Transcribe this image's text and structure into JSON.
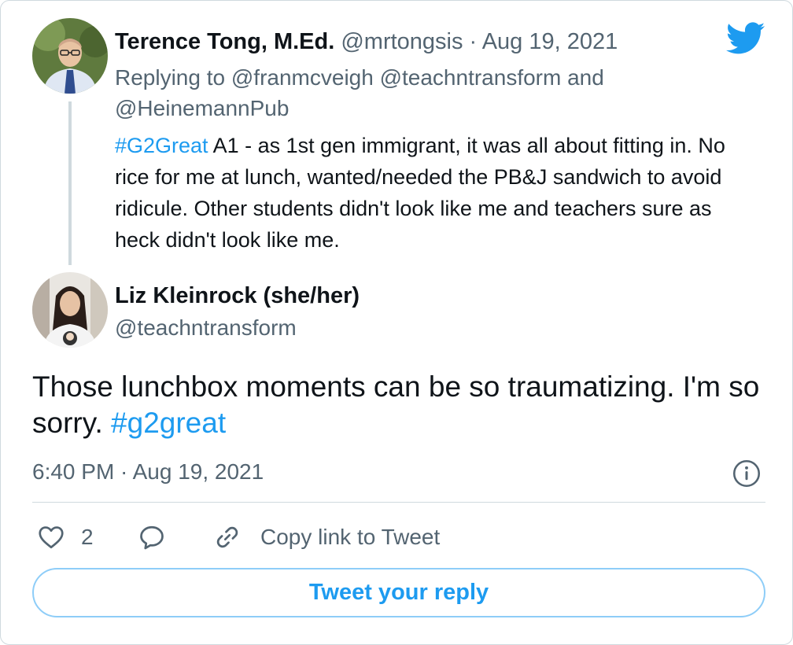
{
  "parent_tweet": {
    "author_name": "Terence Tong, M.Ed.",
    "author_handle": "@mrtongsis",
    "separator": "·",
    "date": "Aug 19, 2021",
    "replying_prefix": "Replying to ",
    "replying_to": "@franmcveigh @teachntransform and @HeinemannPub",
    "hashtag": "#G2Great",
    "text": " A1 - as 1st gen immigrant, it was all about fitting in. No rice for me at lunch, wanted/needed the PB&J sandwich to avoid ridicule. Other students didn't look like me and teachers sure as heck didn't look like me."
  },
  "main_tweet": {
    "author_name": "Liz Kleinrock (she/her)",
    "author_handle": "@teachntransform",
    "text": "Those lunchbox moments can be so traumatizing. I'm so sorry. ",
    "hashtag": "#g2great",
    "timestamp": "6:40 PM · Aug 19, 2021"
  },
  "actions": {
    "like_count": "2",
    "copy_link_label": "Copy link to Tweet",
    "reply_button_label": "Tweet your reply"
  },
  "icons": {
    "brand": "twitter-bird-icon",
    "info": "info-icon",
    "like": "heart-icon",
    "reply": "speech-bubble-icon",
    "link": "link-icon"
  },
  "colors": {
    "brand_blue": "#1d9bf0",
    "muted_text": "#536471",
    "border": "#cfd9de",
    "reply_border": "#8ecdf8"
  }
}
